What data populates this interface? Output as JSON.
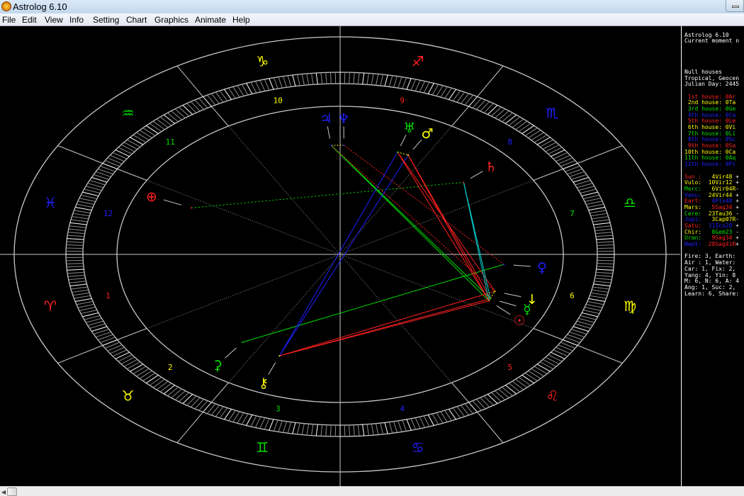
{
  "window": {
    "title": "Astrolog 6.10",
    "app_icon": "astrolog-icon"
  },
  "menu": [
    "File",
    "Edit",
    "View",
    "Info",
    "Setting",
    "Chart",
    "Graphics",
    "Animate",
    "Help"
  ],
  "colors": {
    "fire": "#ff2020",
    "earth": "#ffff00",
    "air": "#00e000",
    "water": "#2020ff",
    "grid": "#c8c8c8",
    "text": "#ffffff"
  },
  "signs": [
    {
      "name": "Aries",
      "glyph": "♈"
    },
    {
      "name": "Taurus",
      "glyph": "♉"
    },
    {
      "name": "Gemini",
      "glyph": "♊"
    },
    {
      "name": "Cancer",
      "glyph": "♋"
    },
    {
      "name": "Leo",
      "glyph": "♌"
    },
    {
      "name": "Virgo",
      "glyph": "♍"
    },
    {
      "name": "Libra",
      "glyph": "♎"
    },
    {
      "name": "Scorpio",
      "glyph": "♏"
    },
    {
      "name": "Sagittarius",
      "glyph": "♐"
    },
    {
      "name": "Capricorn",
      "glyph": "♑"
    },
    {
      "name": "Aquarius",
      "glyph": "♒"
    },
    {
      "name": "Pisces",
      "glyph": "♓"
    }
  ],
  "houses": [
    "1",
    "2",
    "3",
    "4",
    "5",
    "6",
    "7",
    "8",
    "9",
    "10",
    "11",
    "12"
  ],
  "planets": [
    {
      "name": "Sun",
      "glyph": "☉",
      "lon": 154.8,
      "color": "#ff2020"
    },
    {
      "name": "Vulcan",
      "glyph": "↓",
      "lon": 160.2,
      "color": "#ffff00"
    },
    {
      "name": "Mercury",
      "glyph": "☿",
      "lon": 156.07,
      "color": "#00e000"
    },
    {
      "name": "Venus",
      "glyph": "♀",
      "lon": 174.73,
      "color": "#2020ff"
    },
    {
      "name": "Earth",
      "glyph": "⊕",
      "lon": 334.8,
      "color": "#ff2020"
    },
    {
      "name": "Mars",
      "glyph": "♂",
      "lon": 245.57,
      "color": "#ffff00"
    },
    {
      "name": "Ceres",
      "glyph": "⚳",
      "lon": 53.6,
      "color": "#00e000"
    },
    {
      "name": "Jupiter",
      "glyph": "♃",
      "lon": 273.12,
      "color": "#2020ff"
    },
    {
      "name": "Saturn",
      "glyph": "♄",
      "lon": 221.33,
      "color": "#ff2020"
    },
    {
      "name": "Chiron",
      "glyph": "⚷",
      "lon": 68.38,
      "color": "#ffff00"
    },
    {
      "name": "Uranus",
      "glyph": "♅",
      "lon": 249.57,
      "color": "#00e000"
    },
    {
      "name": "Neptune",
      "glyph": "♆",
      "lon": 268.68,
      "color": "#2020ff"
    }
  ],
  "aspect_colors": {
    "conjunction": "#ffff00",
    "opposition": "#2020ff",
    "square": "#ff2020",
    "trine": "#00e000",
    "sextile": "#00d0d0"
  },
  "aspects": [
    {
      "a": "Jupiter",
      "b": "Neptune",
      "type": "conjunction"
    },
    {
      "a": "Uranus",
      "b": "Mars",
      "type": "conjunction"
    },
    {
      "a": "Sun",
      "b": "Mercury",
      "type": "conjunction"
    },
    {
      "a": "Sun",
      "b": "Vulcan",
      "type": "conjunction"
    },
    {
      "a": "Jupiter",
      "b": "Sun",
      "type": "trine"
    },
    {
      "a": "Jupiter",
      "b": "Mercury",
      "type": "trine"
    },
    {
      "a": "Ceres",
      "b": "Venus",
      "type": "trine"
    },
    {
      "a": "Earth",
      "b": "Saturn",
      "type": "trine"
    },
    {
      "a": "Chiron",
      "b": "Uranus",
      "type": "opposition"
    },
    {
      "a": "Chiron",
      "b": "Mars",
      "type": "opposition"
    },
    {
      "a": "Chiron",
      "b": "Sun",
      "type": "square"
    },
    {
      "a": "Chiron",
      "b": "Mercury",
      "type": "square"
    },
    {
      "a": "Chiron",
      "b": "Vulcan",
      "type": "square"
    },
    {
      "a": "Uranus",
      "b": "Sun",
      "type": "square"
    },
    {
      "a": "Mars",
      "b": "Mercury",
      "type": "square"
    },
    {
      "a": "Uranus",
      "b": "Vulcan",
      "type": "square"
    },
    {
      "a": "Mars",
      "b": "Sun",
      "type": "square"
    },
    {
      "a": "Neptune",
      "b": "Venus",
      "type": "square"
    },
    {
      "a": "Jupiter",
      "b": "Vulcan",
      "type": "square"
    },
    {
      "a": "Saturn",
      "b": "Sun",
      "type": "sextile"
    },
    {
      "a": "Saturn",
      "b": "Mercury",
      "type": "sextile"
    }
  ],
  "panel": {
    "header": [
      "Astrolog 6.10",
      "Current moment n"
    ],
    "info": [
      "Null houses",
      "Tropical, Geocen",
      "Julian Day: 2445"
    ],
    "house_rows": [
      {
        "label": " 1st house: ",
        "value": "0Ar",
        "color": "#ff2020"
      },
      {
        "label": " 2nd house: ",
        "value": "0Ta",
        "color": "#ffff00"
      },
      {
        "label": " 3rd house: ",
        "value": "0Ge",
        "color": "#00e000"
      },
      {
        "label": " 4th house: ",
        "value": "0Ca",
        "color": "#2020ff"
      },
      {
        "label": " 5th house: ",
        "value": "0Le",
        "color": "#ff2020"
      },
      {
        "label": " 6th house: ",
        "value": "0Vi",
        "color": "#ffff00"
      },
      {
        "label": " 7th house: ",
        "value": "0Li",
        "color": "#00e000"
      },
      {
        "label": " 8th house: ",
        "value": "0Sc",
        "color": "#2020ff"
      },
      {
        "label": " 9th house: ",
        "value": "0Sa",
        "color": "#ff2020"
      },
      {
        "label": "10th house: ",
        "value": "0Ca",
        "color": "#ffff00"
      },
      {
        "label": "11th house: ",
        "value": "0Aq",
        "color": "#00e000"
      },
      {
        "label": "12th house: ",
        "value": "0Pi",
        "color": "#2020ff"
      }
    ],
    "planet_rows": [
      {
        "label": "Sun : ",
        "value": "  4Vir48 ",
        "sign": "+",
        "lc": "#ff2020",
        "vc": "#ffff00"
      },
      {
        "label": "Vulo: ",
        "value": " 10Vir12 ",
        "sign": "+",
        "lc": "#ffff00",
        "vc": "#ffff00"
      },
      {
        "label": "Merc: ",
        "value": "  6Vir04R",
        "sign": "-",
        "lc": "#00e000",
        "vc": "#ffff00"
      },
      {
        "label": "Venu: ",
        "value": " 24Vir44 ",
        "sign": "+",
        "lc": "#2020ff",
        "vc": "#ffff00"
      },
      {
        "label": "Eart: ",
        "value": "  4Pis48 ",
        "sign": "+",
        "lc": "#ff2020",
        "vc": "#2020ff"
      },
      {
        "label": "Mars: ",
        "value": "  5Sag34 ",
        "sign": "+",
        "lc": "#ffff00",
        "vc": "#ff2020"
      },
      {
        "label": "Cere: ",
        "value": " 23Tau36 ",
        "sign": "-",
        "lc": "#00e000",
        "vc": "#ffff00"
      },
      {
        "label": "Jupi: ",
        "value": "  3Cap07R",
        "sign": "-",
        "lc": "#2020ff",
        "vc": "#ffff00"
      },
      {
        "label": "Satu: ",
        "value": " 11Sco20 ",
        "sign": "+",
        "lc": "#ff2020",
        "vc": "#2020ff"
      },
      {
        "label": "Chir: ",
        "value": "  8Gem23 ",
        "sign": "-",
        "lc": "#ffff00",
        "vc": "#00e000"
      },
      {
        "label": "Uran: ",
        "value": "  9Sag34 ",
        "sign": "+",
        "lc": "#00e000",
        "vc": "#ff2020"
      },
      {
        "label": "Nept: ",
        "value": " 28Sag41R",
        "sign": "+",
        "lc": "#2020ff",
        "vc": "#ff2020"
      }
    ],
    "stats": [
      "Fire: 3, Earth:",
      "Air : 1, Water:",
      "Car: 1, Fix: 2,",
      "Yang: 4, Yin: 8",
      "M: 6, N: 6, A: 4",
      "Ang: 1, Suc: 2,",
      "Learn: 6, Share:"
    ]
  }
}
